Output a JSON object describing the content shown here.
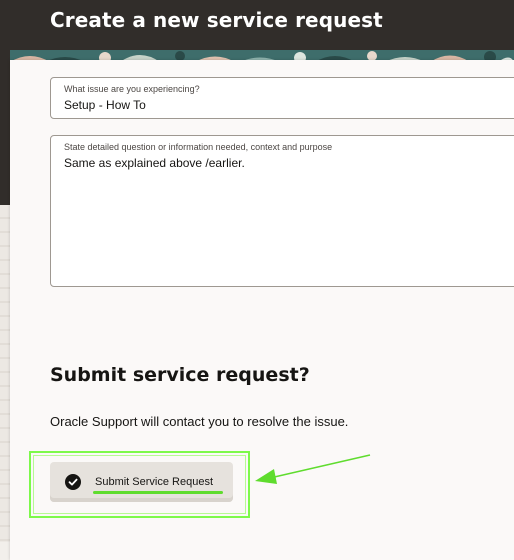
{
  "page": {
    "title": "Create a new service request"
  },
  "form": {
    "issue_field": {
      "label": "What issue are you experiencing?",
      "value": "Setup - How To"
    },
    "details_field": {
      "label": "State detailed question or information needed, context and purpose",
      "value": "Same as explained above /earlier."
    }
  },
  "submit_section": {
    "heading": "Submit service request?",
    "description": "Oracle Support will contact you to resolve the issue.",
    "button_label": "Submit Service Request",
    "button_icon": "check-circle-icon"
  },
  "annotations": {
    "highlight_color": "#7df94a",
    "arrow_color": "#5fdc2e"
  },
  "colors": {
    "header_bg": "#312d2a",
    "card_bg": "#fbf9f8",
    "text": "#161513"
  }
}
